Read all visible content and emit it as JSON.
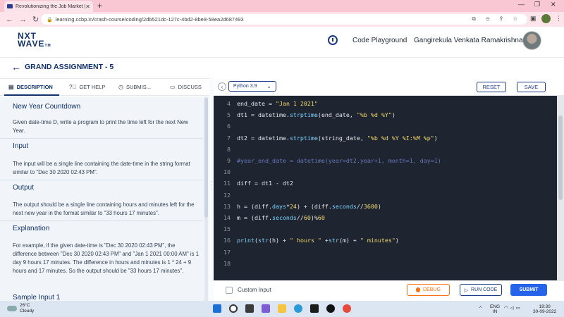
{
  "browser": {
    "tab_title": "Revolutionizing the Job Market |",
    "url": "learning.ccbp.in/crash-course/coding/2db521dc-127c-4bd2-8be8-58ea2d687493"
  },
  "header": {
    "logo_line1": "NXT",
    "logo_line2": "WAVE",
    "logo_tm": "TM",
    "code_playground": "Code Playground",
    "username": "Gangirekula Venkata Ramakrishna"
  },
  "assignment": {
    "title": "GRAND ASSIGNMENT - 5"
  },
  "panel_tabs": [
    {
      "label": "DESCRIPTION",
      "icon": "book-icon"
    },
    {
      "label": "GET HELP",
      "icon": "help-icon"
    },
    {
      "label": "SUBMIS...",
      "icon": "clock-icon"
    },
    {
      "label": "DISCUSS",
      "icon": "chat-icon"
    }
  ],
  "description": {
    "title": "New Year Countdown",
    "intro": "Given date-time D, write a program to print the time left for the next New Year.",
    "input_head": "Input",
    "input_text": "The input will be a single line containing the date-time in the string format similar to \"Dec 30 2020 02:43 PM\".",
    "output_head": "Output",
    "output_text": "The output should be a single line containing hours and minutes left for the next new year in the format similar to \"33 hours 17 minutes\".",
    "explanation_head": "Explanation",
    "explanation_text": "For example, if the given date-time is \"Dec 30 2020 02:43 PM\", the difference between \"Dec 30 2020 02:43 PM\" and \"Jan 1 2021 00:00 AM\" is 1 day 9 hours 17 minutes. The difference in hours and minutes is 1 * 24 + 9 hours and 17 minutes. So the output should be \"33 hours 17 minutes\".",
    "sample_head": "Sample Input 1"
  },
  "editor": {
    "language": "Python 3.9",
    "reset_label": "RESET",
    "save_label": "SAVE",
    "lines": [
      {
        "n": "4",
        "tokens": [
          [
            "end_date = ",
            "p"
          ],
          [
            "\"Jan 1 2021\"",
            "s"
          ]
        ]
      },
      {
        "n": "5",
        "tokens": [
          [
            "dt1 = datetime.",
            "p"
          ],
          [
            "strptime",
            "f"
          ],
          [
            "(end_date, ",
            "p"
          ],
          [
            "\"%b %d %Y\"",
            "s"
          ],
          [
            ")",
            "p"
          ]
        ]
      },
      {
        "n": "6",
        "tokens": []
      },
      {
        "n": "7",
        "tokens": [
          [
            "dt2 = datetime.",
            "p"
          ],
          [
            "strptime",
            "f"
          ],
          [
            "(string_date, ",
            "p"
          ],
          [
            "\"%b %d %Y %I:%M %p\"",
            "s"
          ],
          [
            ")",
            "p"
          ]
        ]
      },
      {
        "n": "8",
        "tokens": []
      },
      {
        "n": "9",
        "tokens": [
          [
            "#year_end_date = datetime(year=dt2.year+1, month=1, day=1)",
            "c"
          ]
        ]
      },
      {
        "n": "10",
        "tokens": []
      },
      {
        "n": "11",
        "tokens": [
          [
            "diff = dt1 - dt2",
            "p"
          ]
        ]
      },
      {
        "n": "12",
        "tokens": []
      },
      {
        "n": "13",
        "tokens": [
          [
            "h = (diff.",
            "p"
          ],
          [
            "days",
            "f"
          ],
          [
            "*",
            "p"
          ],
          [
            "24",
            "s"
          ],
          [
            ") + (diff.",
            "p"
          ],
          [
            "seconds",
            "f"
          ],
          [
            "//",
            "p"
          ],
          [
            "3600",
            "s"
          ],
          [
            ")",
            "p"
          ]
        ]
      },
      {
        "n": "14",
        "tokens": [
          [
            "m = (diff.",
            "p"
          ],
          [
            "seconds",
            "f"
          ],
          [
            "//",
            "p"
          ],
          [
            "60",
            "s"
          ],
          [
            ")%",
            "p"
          ],
          [
            "60",
            "s"
          ]
        ]
      },
      {
        "n": "15",
        "tokens": []
      },
      {
        "n": "16",
        "tokens": [
          [
            "print",
            "f"
          ],
          [
            "(",
            "p"
          ],
          [
            "str",
            "f"
          ],
          [
            "(h) + ",
            "p"
          ],
          [
            "\" hours \"",
            "s"
          ],
          [
            " +",
            "p"
          ],
          [
            "str",
            "f"
          ],
          [
            "(m) + ",
            "p"
          ],
          [
            "\" minutes\"",
            "s"
          ],
          [
            ")",
            "p"
          ]
        ]
      },
      {
        "n": "17",
        "tokens": []
      },
      {
        "n": "18",
        "tokens": []
      }
    ]
  },
  "bottom": {
    "custom_input_label": "Custom Input",
    "debug_label": "DEBUG",
    "run_label": "RUN CODE",
    "submit_label": "SUBMIT"
  },
  "taskbar": {
    "temp": "26°C",
    "condition": "Cloudy",
    "lang_line1": "ENG",
    "lang_line2": "IN",
    "time": "19:30",
    "date": "30-09-2022"
  },
  "colors": {
    "brand": "#12326b",
    "accent": "#2563eb",
    "debug": "#f97316",
    "editor_bg": "#1e2430"
  }
}
